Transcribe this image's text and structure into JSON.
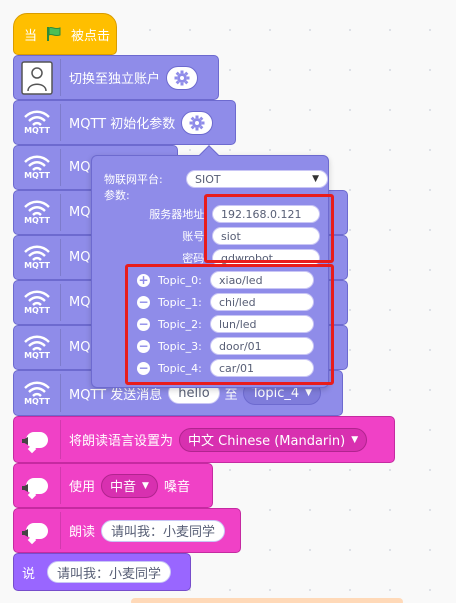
{
  "hat": {
    "prefix": "当",
    "suffix": "被点击"
  },
  "blocks": {
    "switch_account": {
      "label": "切换至独立账户"
    },
    "mqtt_init": {
      "label": "MQTT 初始化参数",
      "icon_text": "MQTT"
    },
    "mqtt_partial_label": "MQ",
    "mqtt_send": {
      "label": "MQTT 发送消息",
      "message": "hello",
      "to": "至",
      "topic": "Topic_4"
    },
    "tts_lang": {
      "label": "将朗读语言设置为",
      "value": "中文 Chinese (Mandarin)"
    },
    "tts_voice": {
      "prefix": "使用",
      "value": "中音",
      "suffix": "嗓音"
    },
    "tts_speak": {
      "label": "朗读",
      "text": "请叫我：小麦同学"
    },
    "say": {
      "label": "说",
      "text": "请叫我：小麦同学"
    }
  },
  "popup": {
    "platform_label": "物联网平台:",
    "platform_value": "SIOT",
    "params_label": "参数:",
    "server_label": "服务器地址:",
    "server_value": "192.168.0.121",
    "account_label": "账号:",
    "account_value": "siot",
    "password_label": "密码:",
    "password_value": "gdwrobot",
    "topics": [
      {
        "label": "Topic_0:",
        "value": "xiao/led",
        "control": "+"
      },
      {
        "label": "Topic_1:",
        "value": "chi/led",
        "control": "−"
      },
      {
        "label": "Topic_2:",
        "value": "lun/led",
        "control": "−"
      },
      {
        "label": "Topic_3:",
        "value": "door/01",
        "control": "−"
      },
      {
        "label": "Topic_4:",
        "value": "car/01",
        "control": "−"
      }
    ]
  },
  "colors": {
    "extension_purple": "#8f8ce9",
    "tts_pink": "#f041c6",
    "event_yellow": "#ffbf00",
    "highlight_red": "#e81c1c",
    "flag_green": "#4cbf56"
  },
  "icons": [
    "green-flag-icon",
    "account-person-icon",
    "wifi-icon",
    "gear-icon",
    "speech-bubble-icon",
    "speaker-icon"
  ]
}
